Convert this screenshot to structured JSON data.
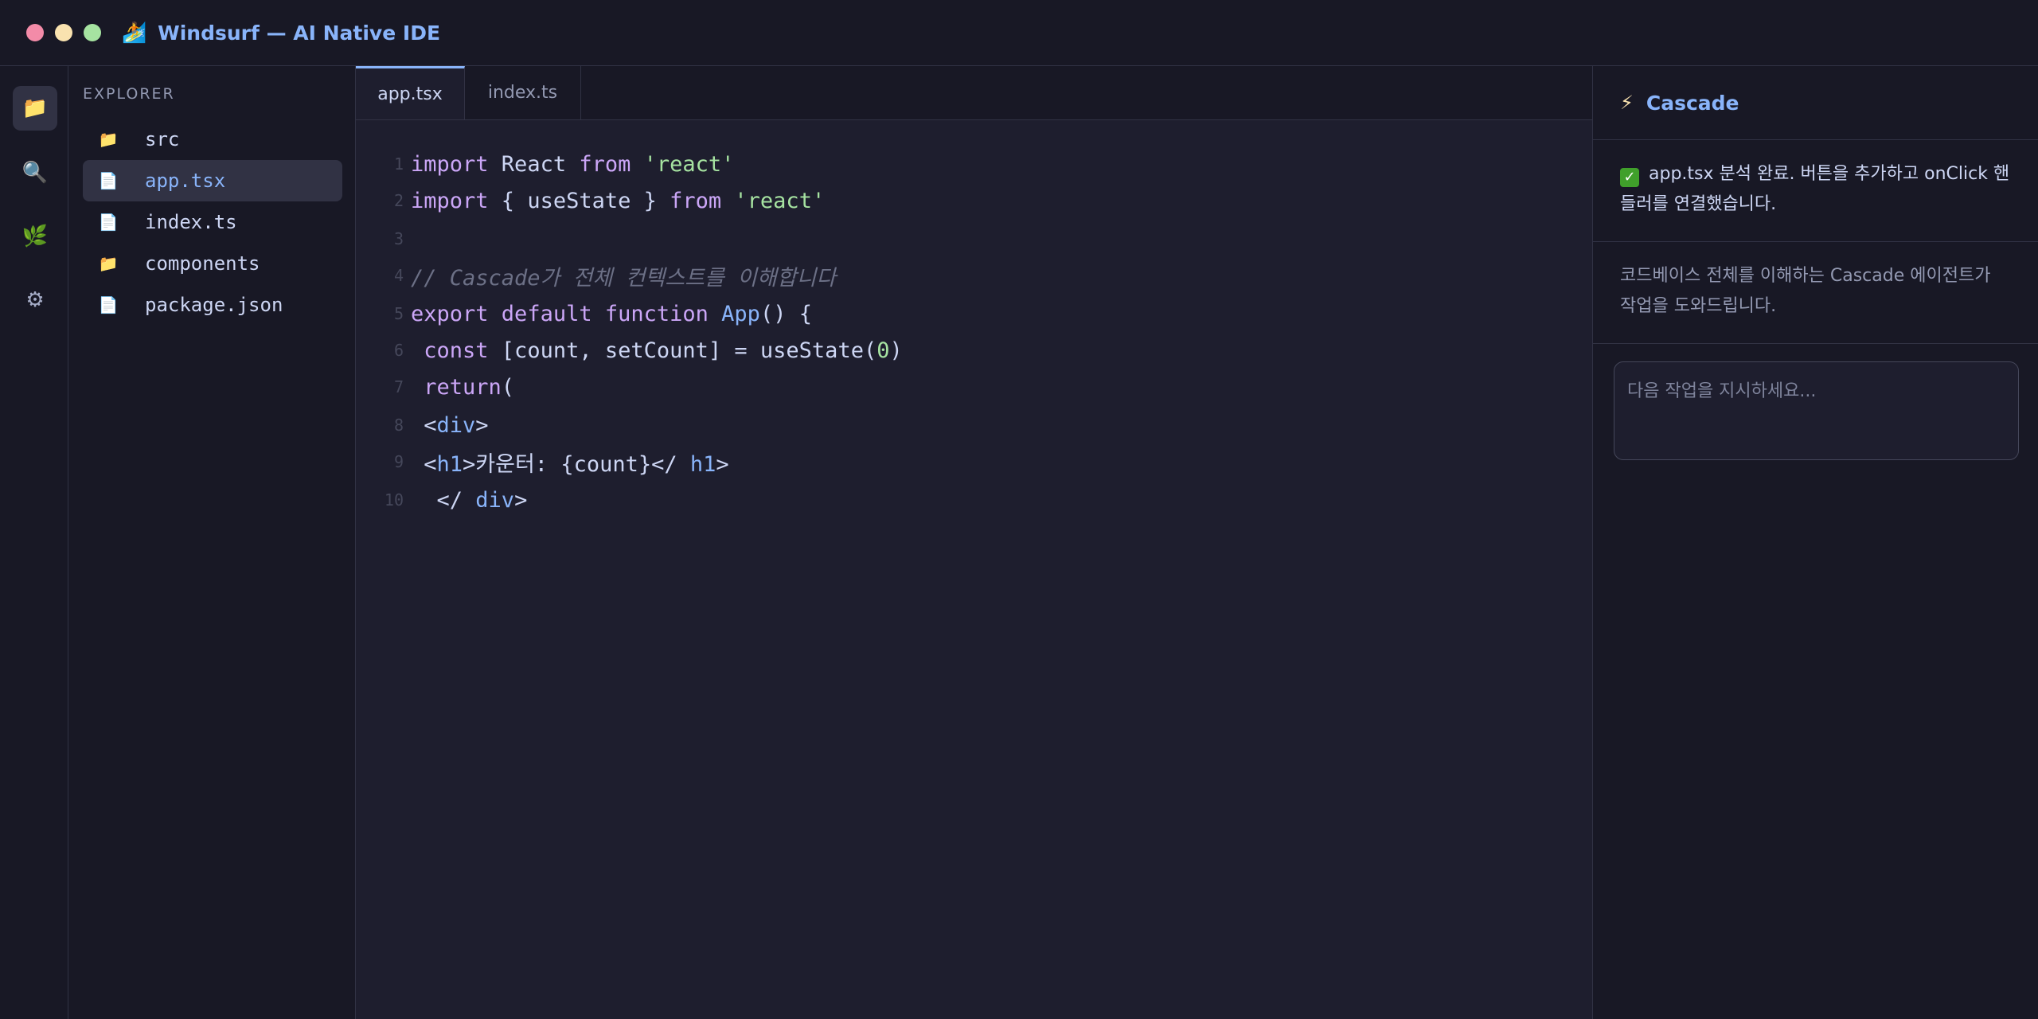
{
  "window": {
    "title": "Windsurf — AI Native IDE",
    "icon": "surfer-icon"
  },
  "activity_bar": {
    "items": [
      {
        "icon": "folder-icon",
        "active": true
      },
      {
        "icon": "search-icon",
        "active": false
      },
      {
        "icon": "source-control-icon",
        "active": false
      },
      {
        "icon": "gear-icon",
        "active": false
      }
    ]
  },
  "explorer": {
    "title": "EXPLORER",
    "items": [
      {
        "label": "src",
        "icon": "folder-icon",
        "active": false
      },
      {
        "label": "app.tsx",
        "icon": "file-icon",
        "active": true
      },
      {
        "label": "index.ts",
        "icon": "file-icon",
        "active": false
      },
      {
        "label": "components",
        "icon": "folder-icon",
        "active": false
      },
      {
        "label": "package.json",
        "icon": "file-icon",
        "active": false
      }
    ]
  },
  "editor": {
    "tabs": [
      {
        "label": "app.tsx",
        "active": true
      },
      {
        "label": "index.ts",
        "active": false
      }
    ],
    "lines": [
      {
        "n": "1",
        "tokens": [
          [
            "kw",
            "import"
          ],
          [
            "",
            "React"
          ],
          [
            "kw",
            "from"
          ],
          [
            "str",
            "'react'"
          ]
        ]
      },
      {
        "n": "2",
        "tokens": [
          [
            "kw",
            "import"
          ],
          [
            "",
            "{ useState }"
          ],
          [
            "kw",
            "from"
          ],
          [
            "str",
            "'react'"
          ]
        ]
      },
      {
        "n": "3",
        "tokens": []
      },
      {
        "n": "4",
        "tokens": [
          [
            "cm",
            "// Cascade가 전체 컨텍스트를 이해합니다"
          ]
        ]
      },
      {
        "n": "5",
        "tokens": [
          [
            "kw",
            "export"
          ],
          [
            "kw",
            "default"
          ],
          [
            "kw",
            "function"
          ],
          [
            "fn",
            "App"
          ],
          [
            "",
            "() {"
          ]
        ]
      },
      {
        "n": "6",
        "tokens": [
          [
            "kw",
            " const"
          ],
          [
            "",
            "[count, setCount] = useState("
          ],
          [
            "num",
            "0"
          ],
          [
            ")",
            ")"
          ]
        ]
      },
      {
        "n": "7",
        "tokens": [
          [
            "kw",
            " return"
          ],
          [
            "",
            "("
          ]
        ]
      },
      {
        "n": "8",
        "tokens": [
          [
            "",
            " <"
          ],
          [
            "tag",
            "div"
          ],
          [
            "",
            ">"
          ]
        ]
      },
      {
        "n": "9",
        "tokens": [
          [
            "",
            " <"
          ],
          [
            "tag",
            "h1"
          ],
          [
            "",
            ">카운터: {count}</"
          ],
          [
            "tag",
            "h1"
          ],
          [
            "",
            ">"
          ]
        ]
      },
      {
        "n": "10",
        "tokens": [
          [
            "",
            "  </"
          ],
          [
            "tag",
            "div"
          ],
          [
            "",
            ">"
          ]
        ]
      }
    ]
  },
  "cascade": {
    "title": "Cascade",
    "icon": "lightning-icon",
    "status_message": "app.tsx 분석 완료. 버튼을 추가하고 onClick 핸들러를 연결했습니다.",
    "status_icon": "check-icon",
    "info_message": "코드베이스 전체를 이해하는 Cascade 에이전트가 작업을 도와드립니다.",
    "input_placeholder": "다음 작업을 지시하세요..."
  }
}
